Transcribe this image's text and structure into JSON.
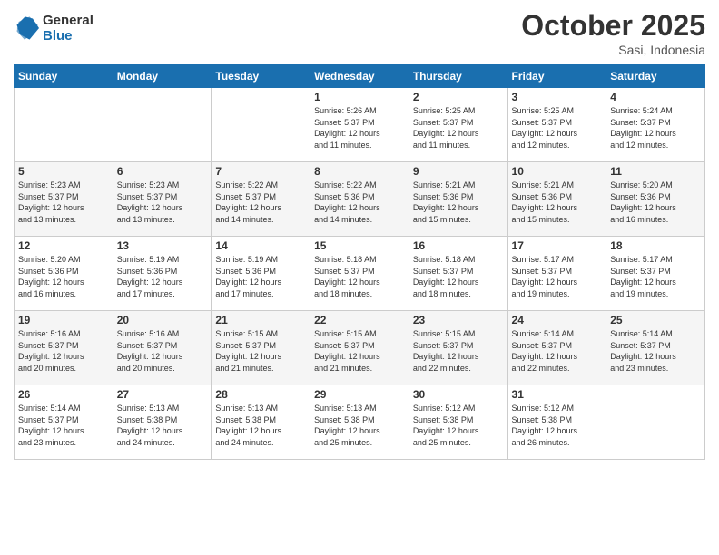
{
  "logo": {
    "line1": "General",
    "line2": "Blue"
  },
  "title": "October 2025",
  "location": "Sasi, Indonesia",
  "weekdays": [
    "Sunday",
    "Monday",
    "Tuesday",
    "Wednesday",
    "Thursday",
    "Friday",
    "Saturday"
  ],
  "weeks": [
    [
      {
        "day": "",
        "info": ""
      },
      {
        "day": "",
        "info": ""
      },
      {
        "day": "",
        "info": ""
      },
      {
        "day": "1",
        "info": "Sunrise: 5:26 AM\nSunset: 5:37 PM\nDaylight: 12 hours\nand 11 minutes."
      },
      {
        "day": "2",
        "info": "Sunrise: 5:25 AM\nSunset: 5:37 PM\nDaylight: 12 hours\nand 11 minutes."
      },
      {
        "day": "3",
        "info": "Sunrise: 5:25 AM\nSunset: 5:37 PM\nDaylight: 12 hours\nand 12 minutes."
      },
      {
        "day": "4",
        "info": "Sunrise: 5:24 AM\nSunset: 5:37 PM\nDaylight: 12 hours\nand 12 minutes."
      }
    ],
    [
      {
        "day": "5",
        "info": "Sunrise: 5:23 AM\nSunset: 5:37 PM\nDaylight: 12 hours\nand 13 minutes."
      },
      {
        "day": "6",
        "info": "Sunrise: 5:23 AM\nSunset: 5:37 PM\nDaylight: 12 hours\nand 13 minutes."
      },
      {
        "day": "7",
        "info": "Sunrise: 5:22 AM\nSunset: 5:37 PM\nDaylight: 12 hours\nand 14 minutes."
      },
      {
        "day": "8",
        "info": "Sunrise: 5:22 AM\nSunset: 5:36 PM\nDaylight: 12 hours\nand 14 minutes."
      },
      {
        "day": "9",
        "info": "Sunrise: 5:21 AM\nSunset: 5:36 PM\nDaylight: 12 hours\nand 15 minutes."
      },
      {
        "day": "10",
        "info": "Sunrise: 5:21 AM\nSunset: 5:36 PM\nDaylight: 12 hours\nand 15 minutes."
      },
      {
        "day": "11",
        "info": "Sunrise: 5:20 AM\nSunset: 5:36 PM\nDaylight: 12 hours\nand 16 minutes."
      }
    ],
    [
      {
        "day": "12",
        "info": "Sunrise: 5:20 AM\nSunset: 5:36 PM\nDaylight: 12 hours\nand 16 minutes."
      },
      {
        "day": "13",
        "info": "Sunrise: 5:19 AM\nSunset: 5:36 PM\nDaylight: 12 hours\nand 17 minutes."
      },
      {
        "day": "14",
        "info": "Sunrise: 5:19 AM\nSunset: 5:36 PM\nDaylight: 12 hours\nand 17 minutes."
      },
      {
        "day": "15",
        "info": "Sunrise: 5:18 AM\nSunset: 5:37 PM\nDaylight: 12 hours\nand 18 minutes."
      },
      {
        "day": "16",
        "info": "Sunrise: 5:18 AM\nSunset: 5:37 PM\nDaylight: 12 hours\nand 18 minutes."
      },
      {
        "day": "17",
        "info": "Sunrise: 5:17 AM\nSunset: 5:37 PM\nDaylight: 12 hours\nand 19 minutes."
      },
      {
        "day": "18",
        "info": "Sunrise: 5:17 AM\nSunset: 5:37 PM\nDaylight: 12 hours\nand 19 minutes."
      }
    ],
    [
      {
        "day": "19",
        "info": "Sunrise: 5:16 AM\nSunset: 5:37 PM\nDaylight: 12 hours\nand 20 minutes."
      },
      {
        "day": "20",
        "info": "Sunrise: 5:16 AM\nSunset: 5:37 PM\nDaylight: 12 hours\nand 20 minutes."
      },
      {
        "day": "21",
        "info": "Sunrise: 5:15 AM\nSunset: 5:37 PM\nDaylight: 12 hours\nand 21 minutes."
      },
      {
        "day": "22",
        "info": "Sunrise: 5:15 AM\nSunset: 5:37 PM\nDaylight: 12 hours\nand 21 minutes."
      },
      {
        "day": "23",
        "info": "Sunrise: 5:15 AM\nSunset: 5:37 PM\nDaylight: 12 hours\nand 22 minutes."
      },
      {
        "day": "24",
        "info": "Sunrise: 5:14 AM\nSunset: 5:37 PM\nDaylight: 12 hours\nand 22 minutes."
      },
      {
        "day": "25",
        "info": "Sunrise: 5:14 AM\nSunset: 5:37 PM\nDaylight: 12 hours\nand 23 minutes."
      }
    ],
    [
      {
        "day": "26",
        "info": "Sunrise: 5:14 AM\nSunset: 5:37 PM\nDaylight: 12 hours\nand 23 minutes."
      },
      {
        "day": "27",
        "info": "Sunrise: 5:13 AM\nSunset: 5:38 PM\nDaylight: 12 hours\nand 24 minutes."
      },
      {
        "day": "28",
        "info": "Sunrise: 5:13 AM\nSunset: 5:38 PM\nDaylight: 12 hours\nand 24 minutes."
      },
      {
        "day": "29",
        "info": "Sunrise: 5:13 AM\nSunset: 5:38 PM\nDaylight: 12 hours\nand 25 minutes."
      },
      {
        "day": "30",
        "info": "Sunrise: 5:12 AM\nSunset: 5:38 PM\nDaylight: 12 hours\nand 25 minutes."
      },
      {
        "day": "31",
        "info": "Sunrise: 5:12 AM\nSunset: 5:38 PM\nDaylight: 12 hours\nand 26 minutes."
      },
      {
        "day": "",
        "info": ""
      }
    ]
  ]
}
